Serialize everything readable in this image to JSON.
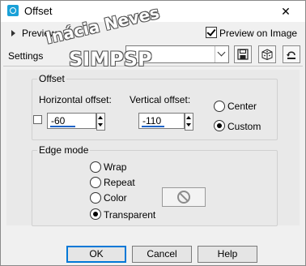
{
  "window": {
    "title": "Offset",
    "close_glyph": "✕"
  },
  "header": {
    "preview_label": "Preview",
    "preview_on_image_label": "Preview on Image",
    "preview_on_image_checked": true
  },
  "settings": {
    "label": "Settings",
    "value": ""
  },
  "offset_group": {
    "title": "Offset",
    "horizontal_label": "Horizontal offset:",
    "horizontal_value": "-60",
    "vertical_label": "Vertical offset:",
    "vertical_value": "-110",
    "options": [
      "Center",
      "Custom"
    ],
    "selected": "Custom"
  },
  "edge_group": {
    "title": "Edge mode",
    "options": [
      "Wrap",
      "Repeat",
      "Color",
      "Transparent"
    ],
    "selected": "Transparent"
  },
  "buttons": {
    "ok": "OK",
    "cancel": "Cancel",
    "help": "Help"
  },
  "watermark": {
    "line1": "Inácia Neves",
    "line2": "SIMPSP"
  },
  "icons": [
    "app-icon",
    "save-icon",
    "randomize-icon",
    "reset-icon",
    "no-color-icon"
  ]
}
